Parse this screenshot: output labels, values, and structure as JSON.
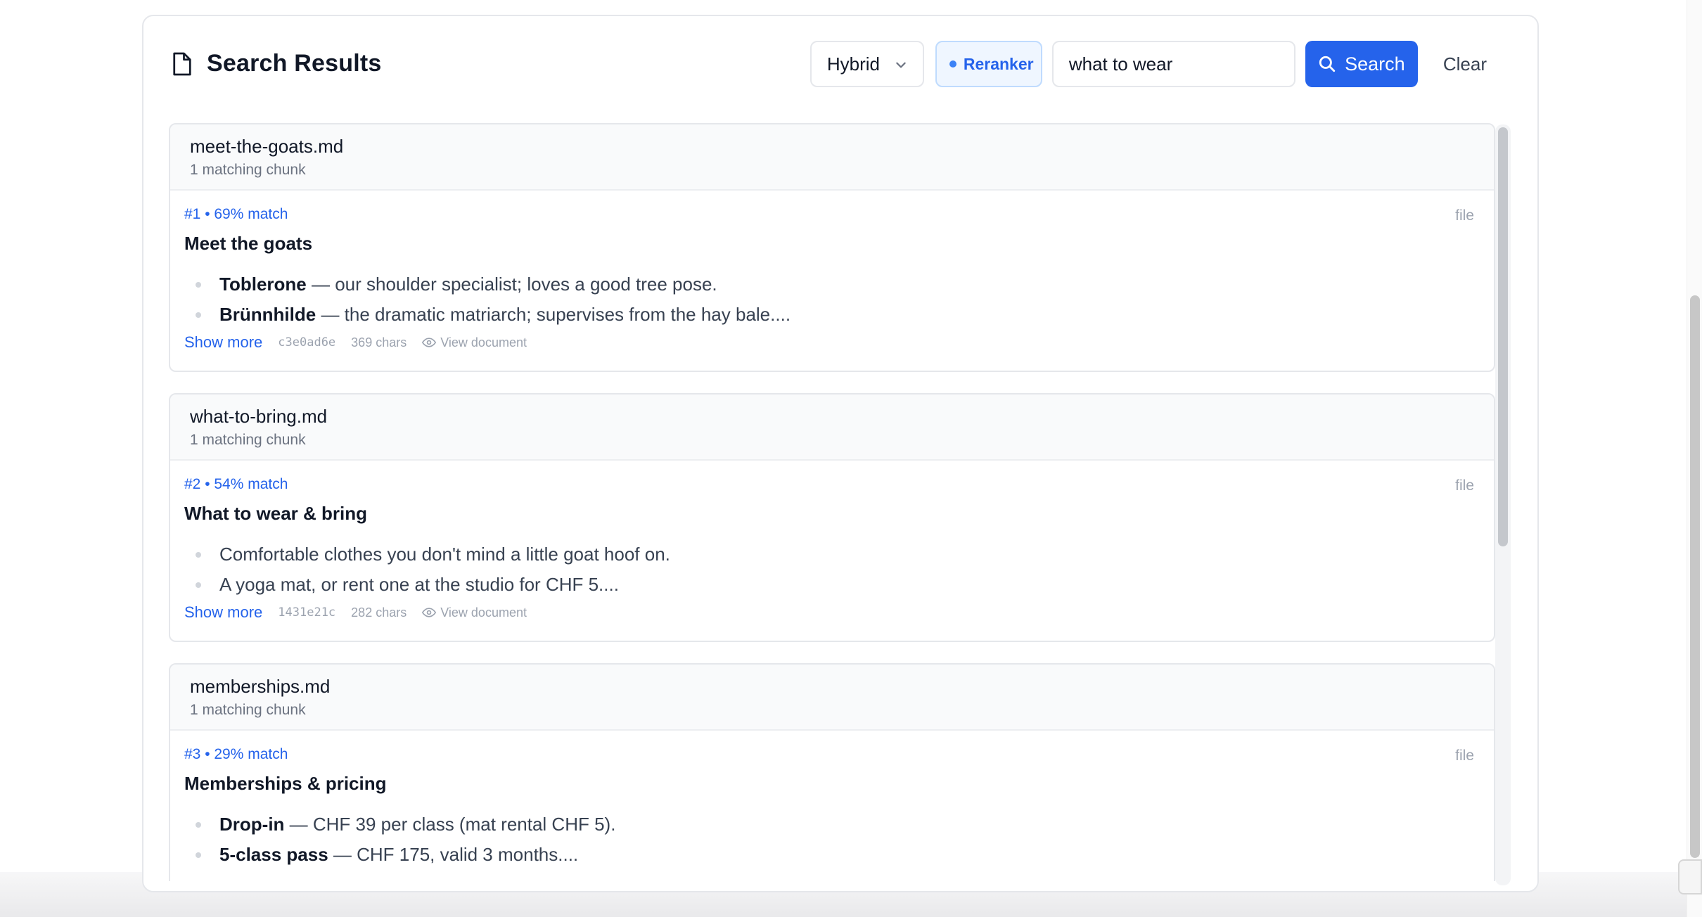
{
  "header": {
    "title": "Search Results",
    "title_icon": "file-icon",
    "mode": "Hybrid",
    "reranker_label": "Reranker",
    "query": "what to wear",
    "search_label": "Search",
    "clear_label": "Clear"
  },
  "results": [
    {
      "file": "meet-the-goats.md",
      "chunks": "1 matching chunk",
      "match": "#1 • 69% match",
      "source": "file",
      "title": "Meet the goats",
      "bullets": [
        {
          "strong": "Toblerone",
          "text": " — our shoulder specialist; loves a good tree pose."
        },
        {
          "strong": "Brünnhilde",
          "text": " — the dramatic matriarch; supervises from the hay bale...."
        }
      ],
      "show_more": "Show more",
      "hash": "c3e0ad6e",
      "chars": "369 chars",
      "view": "View document"
    },
    {
      "file": "what-to-bring.md",
      "chunks": "1 matching chunk",
      "match": "#2 • 54% match",
      "source": "file",
      "title": "What to wear & bring",
      "bullets": [
        {
          "strong": "",
          "text": "Comfortable clothes you don't mind a little goat hoof on."
        },
        {
          "strong": "",
          "text": "A yoga mat, or rent one at the studio for CHF 5...."
        }
      ],
      "show_more": "Show more",
      "hash": "1431e21c",
      "chars": "282 chars",
      "view": "View document"
    },
    {
      "file": "memberships.md",
      "chunks": "1 matching chunk",
      "match": "#3 • 29% match",
      "source": "file",
      "title": "Memberships & pricing",
      "bullets": [
        {
          "strong": "Drop-in",
          "text": " — CHF 39 per class (mat rental CHF 5)."
        },
        {
          "strong": "5-class pass",
          "text": " — CHF 175, valid 3 months...."
        }
      ],
      "show_more": "Show more",
      "hash": "",
      "chars": "",
      "view": ""
    }
  ],
  "colors": {
    "accent": "#2563eb",
    "reranker_bg": "#eff6ff",
    "muted": "#9ca3af"
  }
}
